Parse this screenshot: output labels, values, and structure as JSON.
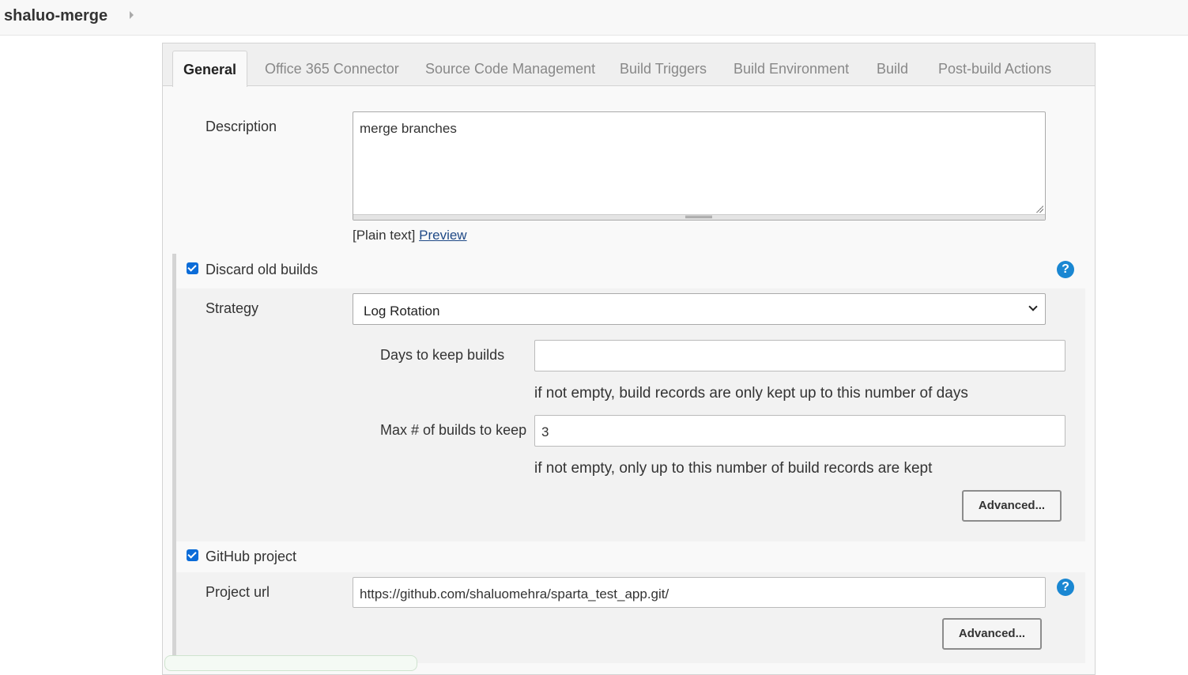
{
  "header": {
    "breadcrumb": "shaluo-merge"
  },
  "tabs": [
    {
      "label": "General",
      "active": true
    },
    {
      "label": "Office 365 Connector"
    },
    {
      "label": "Source Code Management"
    },
    {
      "label": "Build Triggers"
    },
    {
      "label": "Build Environment"
    },
    {
      "label": "Build"
    },
    {
      "label": "Post-build Actions"
    }
  ],
  "description": {
    "label": "Description",
    "value": "merge branches",
    "format_note": "[Plain text]",
    "preview_link": "Preview"
  },
  "discard_old_builds": {
    "label": "Discard old builds",
    "checked": true,
    "help": "?",
    "strategy_label": "Strategy",
    "strategy_value": "Log Rotation",
    "days_label": "Days to keep builds",
    "days_value": "",
    "days_hint": "if not empty, build records are only kept up to this number of days",
    "max_label": "Max # of builds to keep",
    "max_value": "3",
    "max_hint": "if not empty, only up to this number of build records are kept",
    "advanced_label": "Advanced..."
  },
  "github_project": {
    "label": "GitHub project",
    "checked": true,
    "help": "?",
    "url_label": "Project url",
    "url_value": "https://github.com/shaluomehra/sparta_test_app.git/",
    "advanced_label": "Advanced..."
  },
  "colors": {
    "checkbox": "#0b6cd8",
    "help": "#1a87d2",
    "link": "#204a87"
  }
}
